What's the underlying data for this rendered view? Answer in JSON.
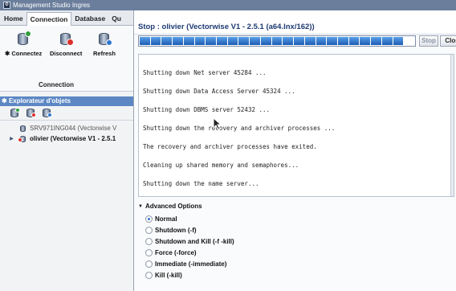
{
  "window": {
    "title": "Management Studio Ingres",
    "icon": "app-icon",
    "icon_glyph": "⚙"
  },
  "ribbon": {
    "tabs": [
      {
        "label": "Home",
        "active": false
      },
      {
        "label": "Connection",
        "active": true
      },
      {
        "label": "Database",
        "active": false
      },
      {
        "label": "Qu",
        "active": false
      }
    ],
    "buttons": [
      {
        "label": "Connectez",
        "icon": "database-connect-icon",
        "glyph": "✱"
      },
      {
        "label": "Disconnect",
        "icon": "database-disconnect-icon",
        "glyph": ""
      },
      {
        "label": "Refresh",
        "icon": "database-refresh-icon",
        "glyph": ""
      }
    ],
    "group_label": "Connection"
  },
  "explorer": {
    "header": "Explorateur d'objets",
    "header_glyph": "✱",
    "toolbar_icons": [
      "connect-icon",
      "disconnect-icon",
      "refresh-icon"
    ],
    "tree": [
      {
        "label": "SRV971ING044 (Vectorwise V",
        "bold": false,
        "expander": "",
        "icon": "server-offline-icon"
      },
      {
        "label": "olivier (Vectorwise V1 - 2.5.1",
        "bold": true,
        "expander": "▶",
        "icon": "server-stopping-icon"
      }
    ]
  },
  "dialog": {
    "title": "Stop : olivier (Vectorwise V1 - 2.5.1 (a64.lnx/162))",
    "progress_fraction": 0.96,
    "stop_label": "Stop",
    "close_label": "Clos",
    "log_lines": [
      "Shutting down Net server 45284 ...",
      "Shutting down Data Access Server 45324 ...",
      "Shutting down DBMS server 52432 ...",
      "Shutting down the recovery and archiver processes ...",
      "The recovery and archiver processes have exited.",
      "Cleaning up shared memory and semaphores...",
      "Shutting down the name server..."
    ],
    "advanced_label": "Advanced Options",
    "advanced_caret": "▼",
    "options": [
      {
        "label": "Normal",
        "checked": true
      },
      {
        "label": "Shutdown (-f)",
        "checked": false
      },
      {
        "label": "Shutdown and Kill (-f -kill)",
        "checked": false
      },
      {
        "label": "Force (-force)",
        "checked": false
      },
      {
        "label": "Immediate (-immediate)",
        "checked": false
      },
      {
        "label": "Kill (-kill)",
        "checked": false
      }
    ]
  },
  "colors": {
    "title_text": "#1d3a72",
    "progress": "#1c5cb3",
    "explorer_header": "#5c87c4"
  }
}
